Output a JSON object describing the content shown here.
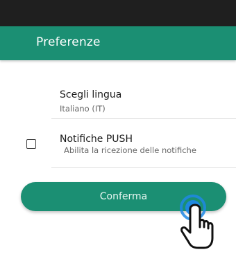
{
  "app_bar": {
    "title": "Preferenze"
  },
  "settings": {
    "language": {
      "title": "Scegli lingua",
      "value": "Italiano (IT)"
    },
    "push": {
      "title": "Notifiche PUSH",
      "description": "Abilita la ricezione delle notifiche",
      "checked": false
    }
  },
  "actions": {
    "confirm_label": "Conferma"
  },
  "icons": {
    "checkbox": "checkbox-unchecked-icon",
    "tap": "hand-pointer-tap-icon"
  },
  "colors": {
    "primary": "#1b8f73",
    "status_bar": "#1f1f1f",
    "tap_ring": "#1e88e5"
  }
}
